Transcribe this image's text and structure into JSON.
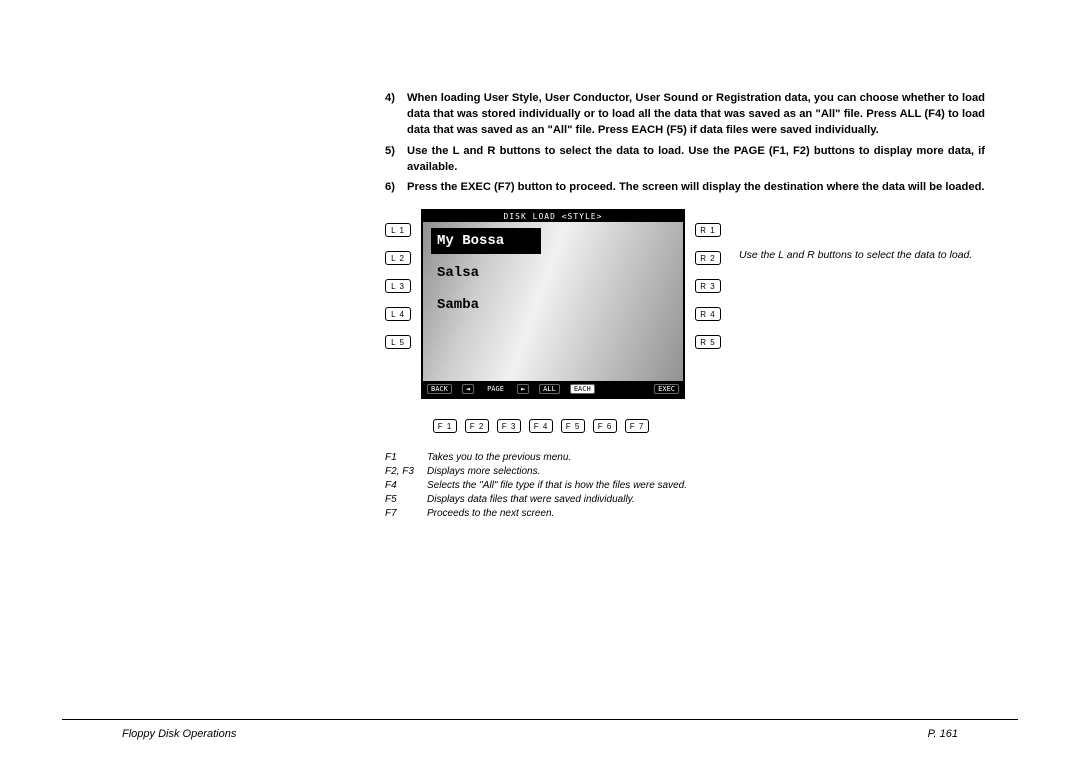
{
  "steps": [
    {
      "num": "4)",
      "text": "When loading User Style, User Conductor, User Sound or Registration data, you can choose whether to load data that was stored individually or to load all the data that was saved as an \"All\" file.  Press ALL (F4) to load data that was saved as an \"All\" file.  Press EACH (F5) if data files were saved individually."
    },
    {
      "num": "5)",
      "text": "Use the L and R buttons to select the data to load.  Use the PAGE (F1, F2) buttons to display more data, if available."
    },
    {
      "num": "6)",
      "text": "Press the EXEC (F7) button to proceed.  The screen will display the destination where the data will be loaded."
    }
  ],
  "screen_title": "DISK LOAD <STYLE>",
  "menu": [
    "My Bossa",
    "Salsa",
    "Samba"
  ],
  "left_buttons": [
    "L 1",
    "L 2",
    "L 3",
    "L 4",
    "L 5"
  ],
  "right_buttons": [
    "R 1",
    "R 2",
    "R 3",
    "R 4",
    "R 5"
  ],
  "footer_buttons": {
    "back": "BACK",
    "page_l": "◄",
    "page_label": "PAGE",
    "page_r": "►",
    "all": "ALL",
    "each": "EACH",
    "exec": "EXEC"
  },
  "f_buttons": [
    "F 1",
    "F 2",
    "F 3",
    "F 4",
    "F 5",
    "F 6",
    "F 7"
  ],
  "caption": "Use the L and R buttons to select the data to load.",
  "legend": [
    {
      "key": "F1",
      "desc": "Takes you to the previous menu."
    },
    {
      "key": "F2, F3",
      "desc": "Displays more selections."
    },
    {
      "key": "F4",
      "desc": "Selects the \"All\" file type if that is how the files were saved."
    },
    {
      "key": "F5",
      "desc": "Displays data files that were saved individually."
    },
    {
      "key": "F7",
      "desc": "Proceeds to the next screen."
    }
  ],
  "footer_title": "Floppy Disk Operations",
  "page_num": "P. 161"
}
